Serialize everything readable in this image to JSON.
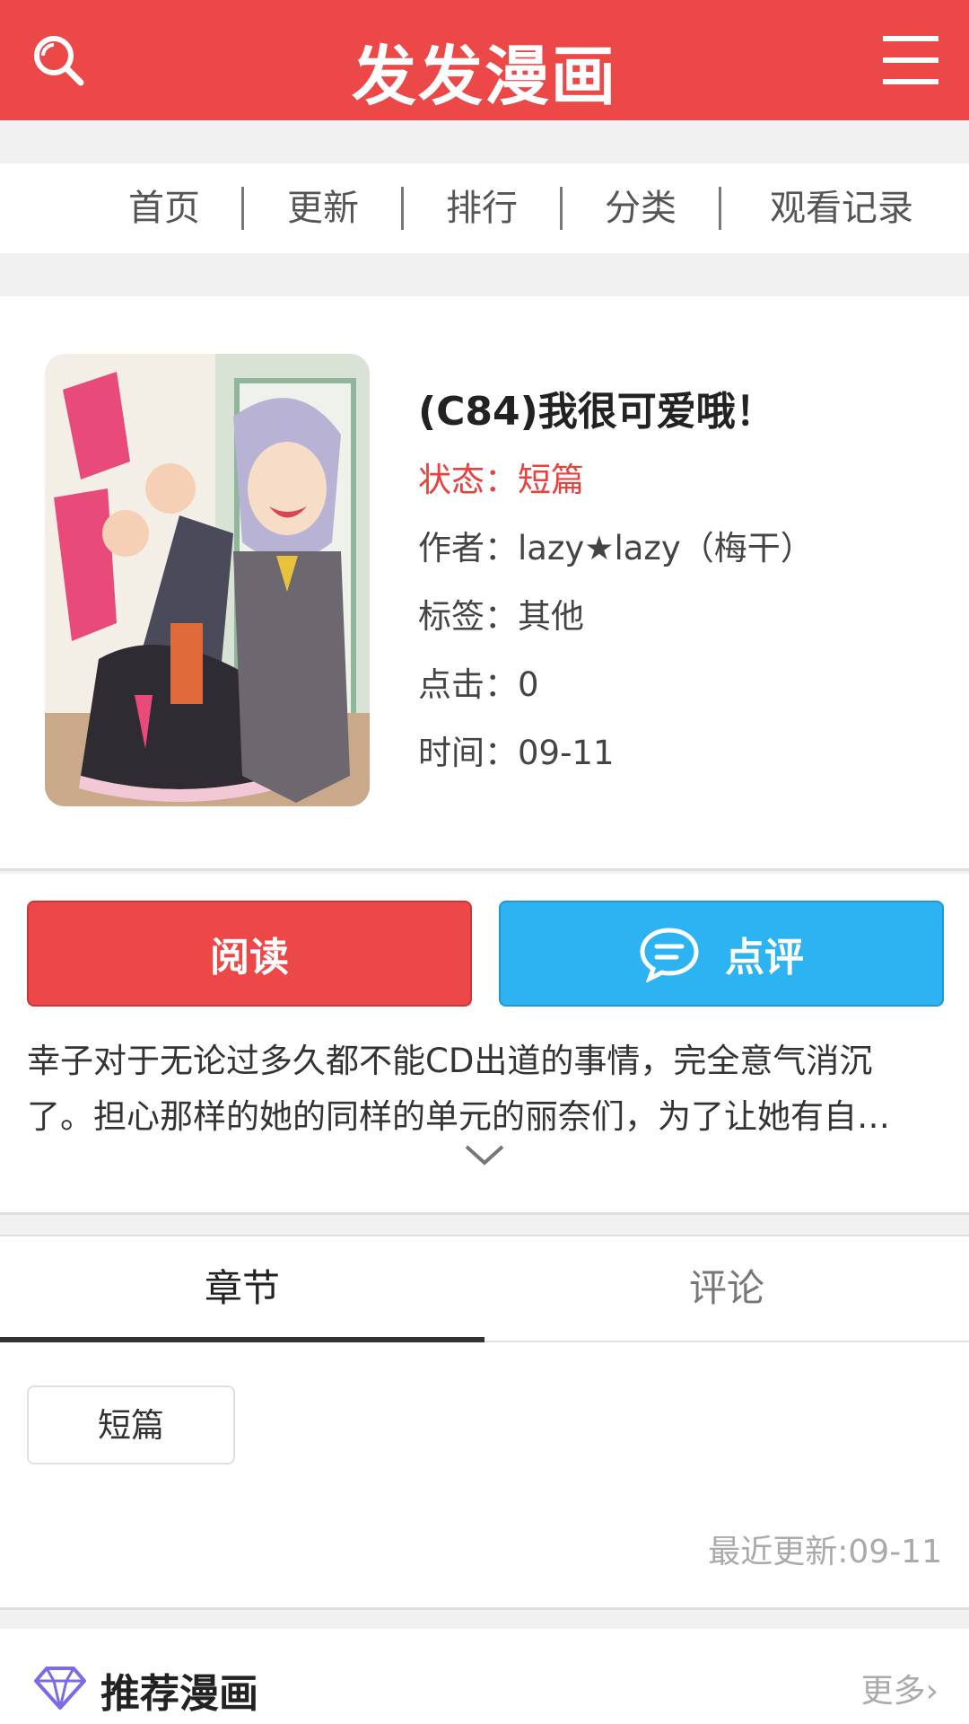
{
  "header": {
    "title": "发发漫画"
  },
  "nav": {
    "items": [
      "首页",
      "更新",
      "排行",
      "分类",
      "观看记录"
    ]
  },
  "comic": {
    "title": "(C84)我很可爱哦！",
    "status": "状态：短篇",
    "author": "作者：lazy★lazy（梅干）",
    "tags": "标签：其他",
    "clicks": "点击：0",
    "time": "时间：09-11"
  },
  "actions": {
    "read_label": "阅读",
    "review_label": "点评"
  },
  "description": {
    "line1": "幸子对于无论过多久都不能CD出道的事情，完全意气消沉",
    "line2": "了。担心那样的她的同样的单元的丽奈们，为了让她有自…"
  },
  "tabs": {
    "chapters_label": "章节",
    "comments_label": "评论"
  },
  "chapters": {
    "items": [
      "短篇"
    ],
    "updated": "最近更新:09-11"
  },
  "recommend": {
    "label": "推荐漫画",
    "more": "更多"
  },
  "colors": {
    "brand_red": "#ec4848",
    "review_blue": "#2db3f1",
    "status_red": "#e8413f"
  }
}
